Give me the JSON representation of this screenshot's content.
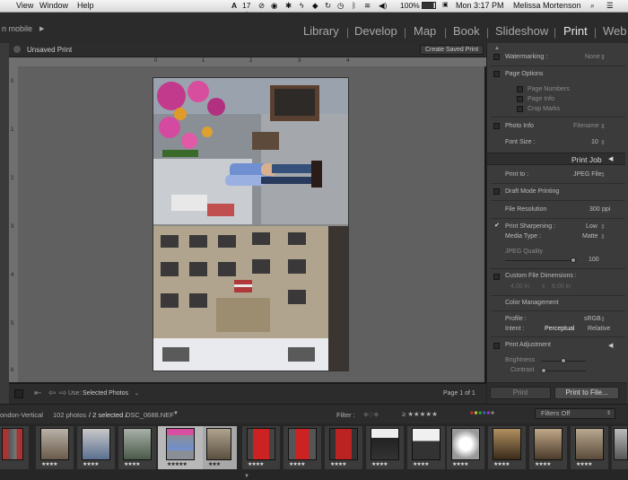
{
  "menubar": {
    "items": [
      "View",
      "Window",
      "Help"
    ],
    "status": {
      "badge": "17",
      "battery": "100%",
      "clock": "Mon 3:17 PM",
      "user": "Melissa Mortenson"
    }
  },
  "modules": {
    "left_label": "n mobile",
    "items": [
      {
        "label": "Library",
        "active": false
      },
      {
        "label": "Develop",
        "active": false
      },
      {
        "label": "Map",
        "active": false
      },
      {
        "label": "Book",
        "active": false
      },
      {
        "label": "Slideshow",
        "active": false
      },
      {
        "label": "Print",
        "active": true
      },
      {
        "label": "Web",
        "active": false
      }
    ]
  },
  "center": {
    "title": "Unsaved Print",
    "save_button": "Create Saved Print",
    "ruler_marks": [
      "0",
      "1",
      "2",
      "3",
      "4"
    ],
    "ruler_left_marks": [
      "0",
      "1",
      "2",
      "3",
      "4",
      "5",
      "6",
      "7"
    ],
    "footer": {
      "use_label": "Use:",
      "use_value": "Selected Photos",
      "page_info": "Page 1 of 1"
    }
  },
  "rightpanel": {
    "watermarking": {
      "label": "Watermarking :",
      "value": "None"
    },
    "page_options": {
      "title": "Page Options",
      "items": [
        "Page Numbers",
        "Page Info",
        "Crop Marks"
      ]
    },
    "photo_info": {
      "label": "Photo Info",
      "value": "Filename"
    },
    "font_size": {
      "label": "Font Size :",
      "value": "10"
    },
    "print_job": {
      "title": "Print Job"
    },
    "print_to": {
      "label": "Print to :",
      "value": "JPEG File"
    },
    "draft_mode": "Draft Mode Printing",
    "file_resolution": {
      "label": "File Resolution",
      "value": "300",
      "unit": "ppi"
    },
    "sharpening": {
      "label": "Print Sharpening :",
      "value": "Low"
    },
    "media_type": {
      "label": "Media Type :",
      "value": "Matte"
    },
    "jpeg_quality": {
      "label": "JPEG Quality",
      "value": "100",
      "level": 0.95
    },
    "custom_dims": {
      "label": "Custom File Dimensions :",
      "w": "4.00 in",
      "x": "x",
      "h": "6.00 in"
    },
    "color_management": {
      "title": "Color Management"
    },
    "profile": {
      "label": "Profile :",
      "value": "sRGB"
    },
    "intent": {
      "label": "Intent :",
      "opt1": "Perceptual",
      "opt2": "Relative"
    },
    "print_adjustment": {
      "title": "Print Adjustment"
    },
    "brightness": {
      "label": "Brightness",
      "level": 0.5
    },
    "contrast": {
      "label": "Contrast",
      "level": 0.05
    },
    "print_button": "Print",
    "print_to_file_button": "Print to File..."
  },
  "filmbar": {
    "source": "ondon-Vertical",
    "count": "102 photos",
    "selected": "/ 2 selected /",
    "filename": "DSC_0688.NEF",
    "filter_label": "Filter :",
    "filter_value": "Filters Off"
  },
  "colors": {
    "accent": "#e8e8e8",
    "panel": "#3b3b3b",
    "canvas": "#606060"
  }
}
